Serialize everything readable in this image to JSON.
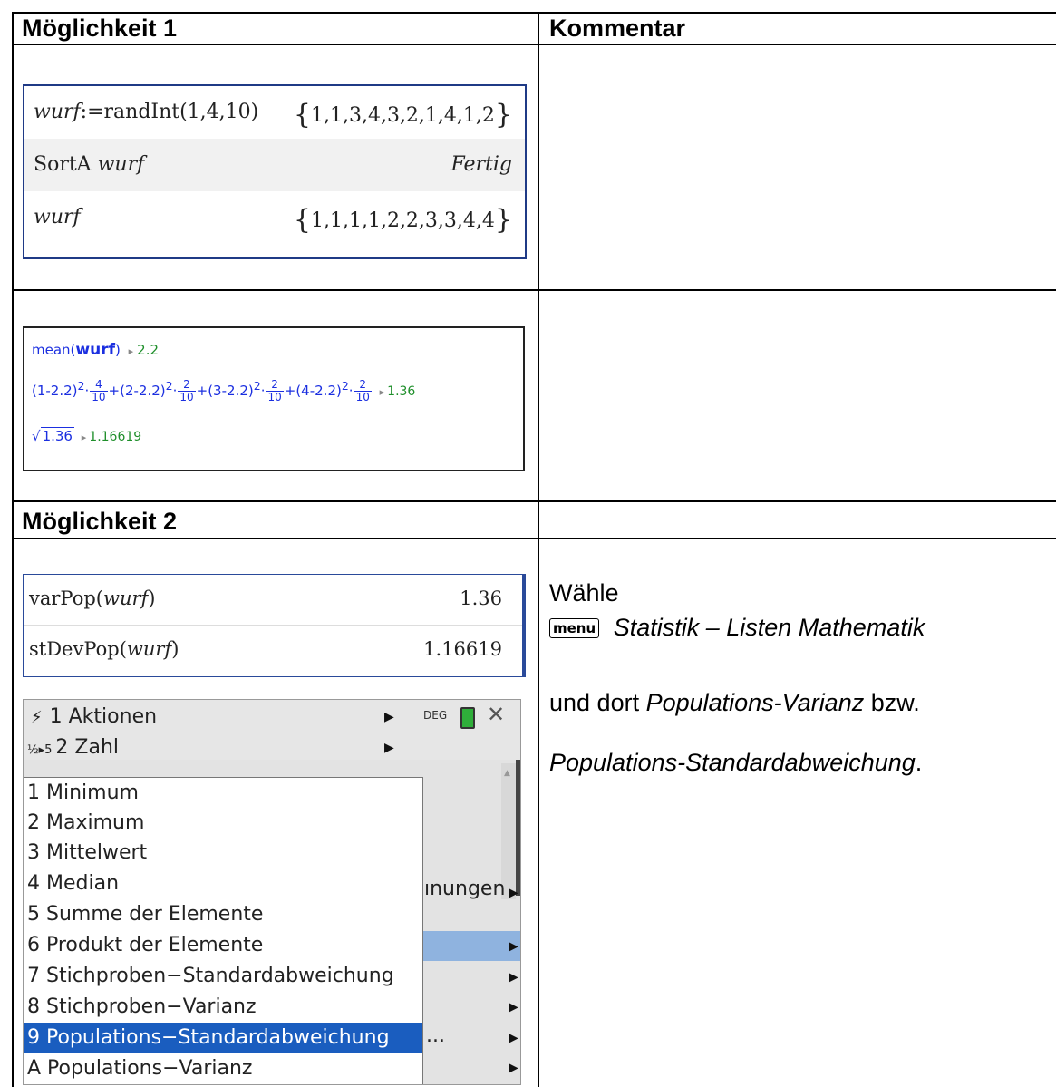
{
  "table": {
    "header_left": "Möglichkeit 1",
    "header_right": "Kommentar",
    "section2_left": "Möglichkeit 2"
  },
  "calc1": {
    "row1_left_var": "wurf",
    "row1_left_func": ":=randInt(1,4,10)",
    "row1_right": "1,1,3,4,3,2,1,4,1,2",
    "row2_left_cmd": "SortA ",
    "row2_left_var": "wurf",
    "row2_right": "Fertig",
    "row3_left": "wurf",
    "row3_right": "1,1,1,1,2,2,3,3,4,4"
  },
  "calc2": {
    "mean_func": "mean(",
    "mean_arg": "wurf",
    "mean_close": ")",
    "arrow": "▸",
    "mean_result": "2.2",
    "t1": "(1-2.2)",
    "t2": "+(2-2.2)",
    "t3": "+(3-2.2)",
    "t4": "+(4-2.2)",
    "sup": "2",
    "dot": "·",
    "f1_num": "4",
    "f2_num": "2",
    "f3_num": "2",
    "f4_num": "2",
    "den": "10",
    "var_result": "1.36",
    "sqrt_sym": "√",
    "sqrt_arg": "1.36",
    "sqrt_result": "1.16619"
  },
  "calc3": {
    "row1_func": "varPop(",
    "row1_var": "wurf",
    "row1_close": ")",
    "row1_result": "1.36",
    "row2_func": "stDevPop(",
    "row2_var": "wurf",
    "row2_close": ")",
    "row2_result": "1.16619"
  },
  "menu": {
    "item1_icon": "⚡",
    "item1": "1  Aktionen",
    "item2_icon": "½▸5",
    "item2": "2  Zahl",
    "mode": "DEG",
    "close": "✕",
    "partial_label": "ınungen",
    "ellipsis": "...",
    "sub_items": [
      "1  Minimum",
      "2  Maximum",
      "3  Mittelwert",
      "4  Median",
      "5  Summe der Elemente",
      "6  Produkt der Elemente",
      "7  Stichproben−Standardabweichung",
      "8  Stichproben−Varianz",
      "9  Populations−Standardabweichung",
      "A  Populations−Varianz"
    ],
    "selected_index": 8
  },
  "comment": {
    "line1": "Wähle",
    "menu_key": "menu",
    "line2": "Statistik – Listen Mathematik",
    "line3_a": "und dort ",
    "line3_b": "Populations-Varianz",
    "line3_c": " bzw.",
    "line4_a": "Populations-Standardabweichung",
    "line4_b": "."
  }
}
